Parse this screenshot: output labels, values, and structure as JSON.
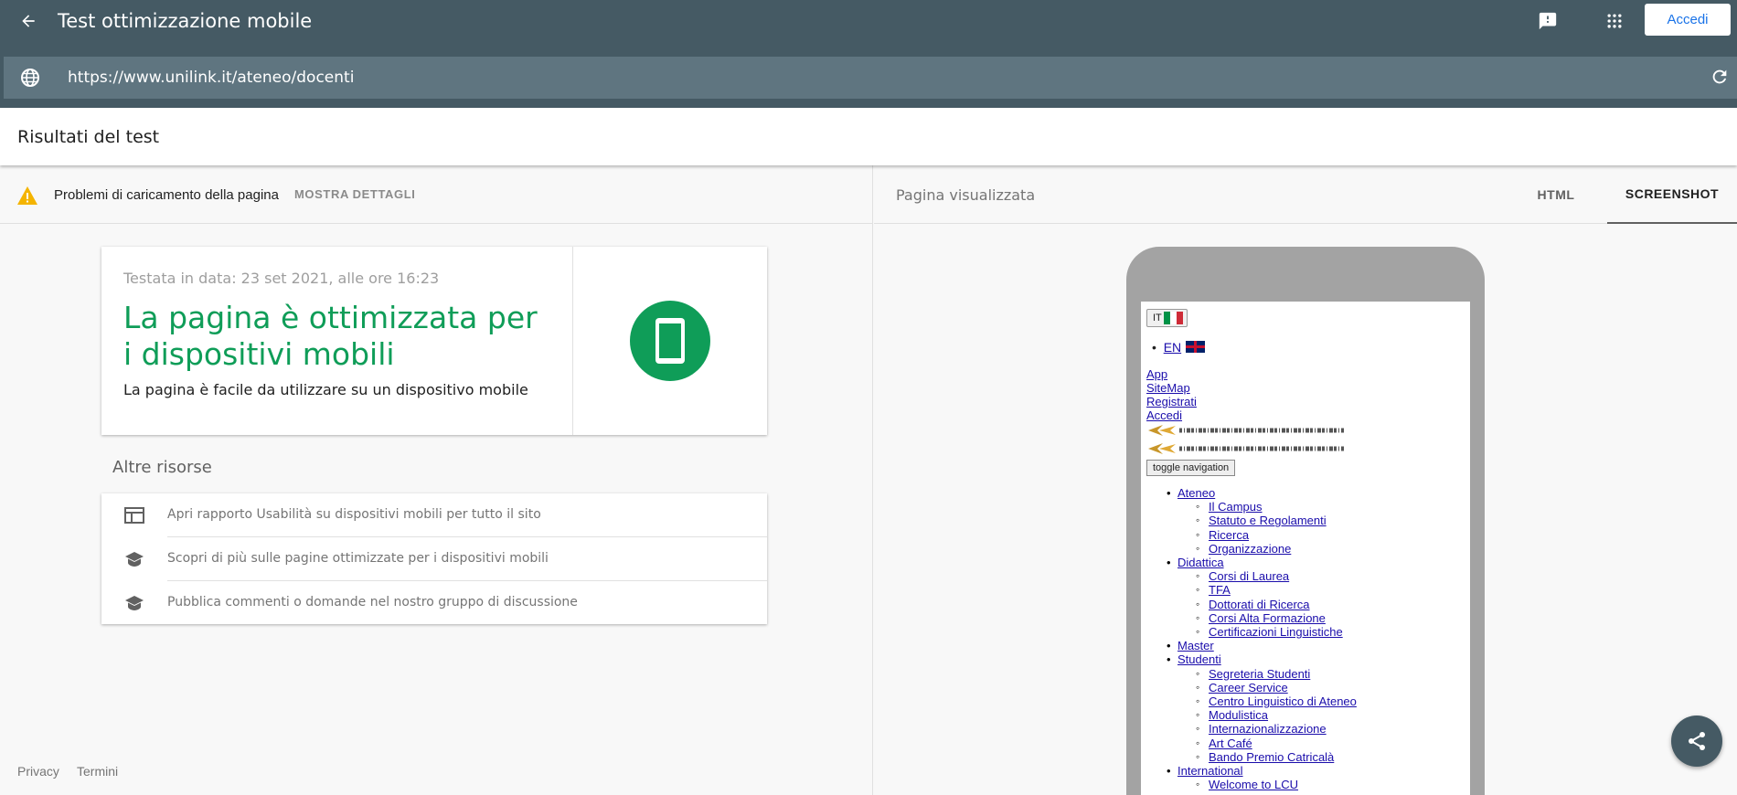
{
  "header": {
    "title": "Test ottimizzazione mobile",
    "signin_label": "Accedi"
  },
  "urlbar": {
    "url": "https://www.unilink.it/ateneo/docenti"
  },
  "results": {
    "title": "Risultati del test"
  },
  "issue": {
    "text": "Problemi di caricamento della pagina",
    "details_label": "MOSTRA DETTAGLI"
  },
  "verdict": {
    "tested": "Testata in data: 23 set 2021, alle ore 16:23",
    "headline": "La pagina è ottimizzata per i dispositivi mobili",
    "subtext": "La pagina è facile da utilizzare su un dispositivo mobile",
    "accent": "#0f9d58"
  },
  "resources": {
    "title": "Altre risorse",
    "items": [
      {
        "label": "Apri rapporto Usabilità su dispositivi mobili per tutto il sito",
        "icon": "web-icon"
      },
      {
        "label": "Scopri di più sulle pagine ottimizzate per i dispositivi mobili",
        "icon": "school-icon"
      },
      {
        "label": "Pubblica commenti o domande nel nostro gruppo di discussione",
        "icon": "school-icon"
      }
    ]
  },
  "footer": {
    "privacy": "Privacy",
    "terms": "Termini"
  },
  "rendered": {
    "title": "Pagina visualizzata",
    "tabs": [
      "HTML",
      "SCREENSHOT"
    ],
    "active_tab": "SCREENSHOT"
  },
  "mobile_page": {
    "lang_it": "IT",
    "lang_en": "EN",
    "top_links": [
      "App",
      "SiteMap",
      "Registrati",
      "Accedi"
    ],
    "toggle": "toggle navigation",
    "nav": [
      {
        "label": "Ateneo",
        "children": [
          "Il Campus",
          "Statuto e Regolamenti",
          "Ricerca",
          "Organizzazione"
        ]
      },
      {
        "label": "Didattica",
        "children": [
          "Corsi di Laurea",
          "TFA",
          "Dottorati di Ricerca",
          "Corsi Alta Formazione",
          "Certificazioni Linguistiche"
        ]
      },
      {
        "label": "Master",
        "children": []
      },
      {
        "label": "Studenti",
        "children": [
          "Segreteria Studenti",
          "Career Service",
          "Centro Linguistico di Ateneo",
          "Modulistica",
          "Internazionalizzazione",
          "Art Café",
          "Bando Premio Catricalà"
        ]
      },
      {
        "label": "International",
        "children": [
          "Welcome to LCU"
        ]
      }
    ]
  }
}
